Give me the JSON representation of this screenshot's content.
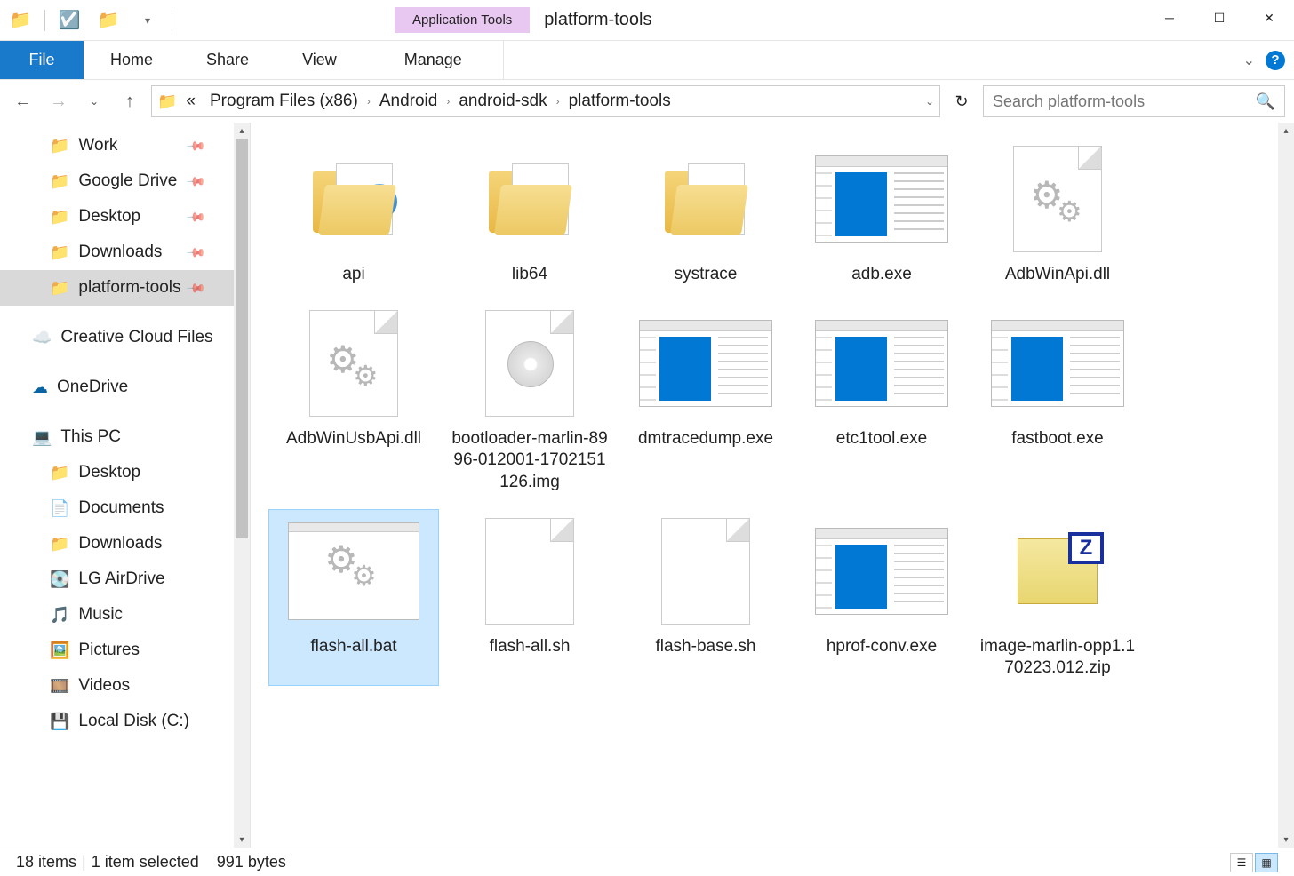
{
  "titlebar": {
    "app_tools": "Application Tools",
    "folder_name": "platform-tools"
  },
  "ribbon": {
    "file": "File",
    "home": "Home",
    "share": "Share",
    "view": "View",
    "manage": "Manage"
  },
  "breadcrumbs": {
    "prefix": "«",
    "c0": "Program Files (x86)",
    "c1": "Android",
    "c2": "android-sdk",
    "c3": "platform-tools"
  },
  "search": {
    "placeholder": "Search platform-tools"
  },
  "sidebar": {
    "work": "Work",
    "gdrive": "Google Drive",
    "desktop": "Desktop",
    "downloads": "Downloads",
    "ptools": "platform-tools",
    "ccf": "Creative Cloud Files",
    "onedrive": "OneDrive",
    "thispc": "This PC",
    "pc_desktop": "Desktop",
    "pc_documents": "Documents",
    "pc_downloads": "Downloads",
    "pc_airdrive": "LG AirDrive",
    "pc_music": "Music",
    "pc_pictures": "Pictures",
    "pc_videos": "Videos",
    "pc_cdrive": "Local Disk (C:)"
  },
  "items": {
    "api": "api",
    "lib64": "lib64",
    "systrace": "systrace",
    "adb": "adb.exe",
    "adbwinapi": "AdbWinApi.dll",
    "adbwinusb": "AdbWinUsbApi.dll",
    "bootloader": "bootloader-marlin-8996-012001-1702151126.img",
    "dmtrace": "dmtracedump.exe",
    "etc1tool": "etc1tool.exe",
    "fastboot": "fastboot.exe",
    "flashall_bat": "flash-all.bat",
    "flashall_sh": "flash-all.sh",
    "flashbase_sh": "flash-base.sh",
    "hprof": "hprof-conv.exe",
    "image_zip": "image-marlin-opp1.170223.012.zip"
  },
  "status": {
    "count": "18 items",
    "selected": "1 item selected",
    "size": "991 bytes"
  }
}
